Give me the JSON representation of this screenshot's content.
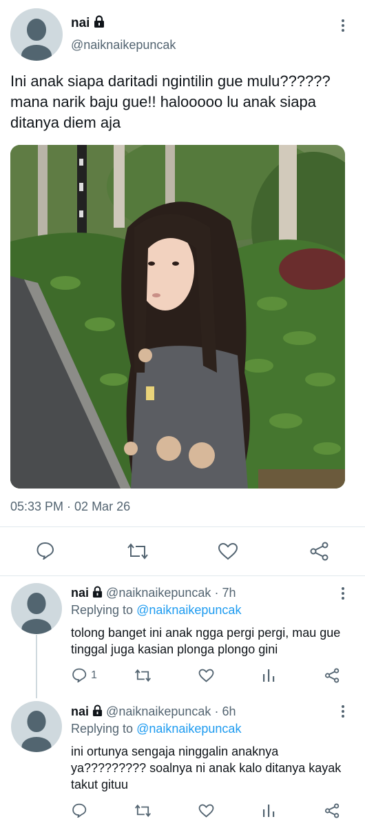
{
  "main": {
    "name": "nai",
    "handle": "@naiknaikepuncak",
    "text": "Ini anak siapa daritadi ngintilin gue mulu?????? mana narik baju gue!! halooooo lu anak siapa ditanya diem aja",
    "timestamp": "05:33 PM · 02 Mar 26"
  },
  "replies": [
    {
      "name": "nai",
      "handle": "@naiknaikepuncak",
      "time": "7h",
      "replying_label": "Replying to",
      "replying_to": "@naiknaikepuncak",
      "text": "tolong banget ini anak ngga pergi pergi, mau gue tinggal juga kasian plonga plongo gini",
      "reply_count": "1"
    },
    {
      "name": "nai",
      "handle": "@naiknaikepuncak",
      "time": "6h",
      "replying_label": "Replying to",
      "replying_to": "@naiknaikepuncak",
      "text": "ini ortunya sengaja ninggalin anaknya ya????????? soalnya ni anak kalo ditanya kayak takut gituu",
      "reply_count": ""
    }
  ],
  "colors": {
    "text": "#0f1419",
    "secondary": "#536471",
    "link": "#1d9bf0",
    "divider": "#e1e8ed",
    "avatar_bg": "#cfd9de"
  },
  "icons": [
    "lock-icon",
    "more-icon",
    "reply-icon",
    "retweet-icon",
    "like-icon",
    "share-icon",
    "analytics-icon"
  ]
}
